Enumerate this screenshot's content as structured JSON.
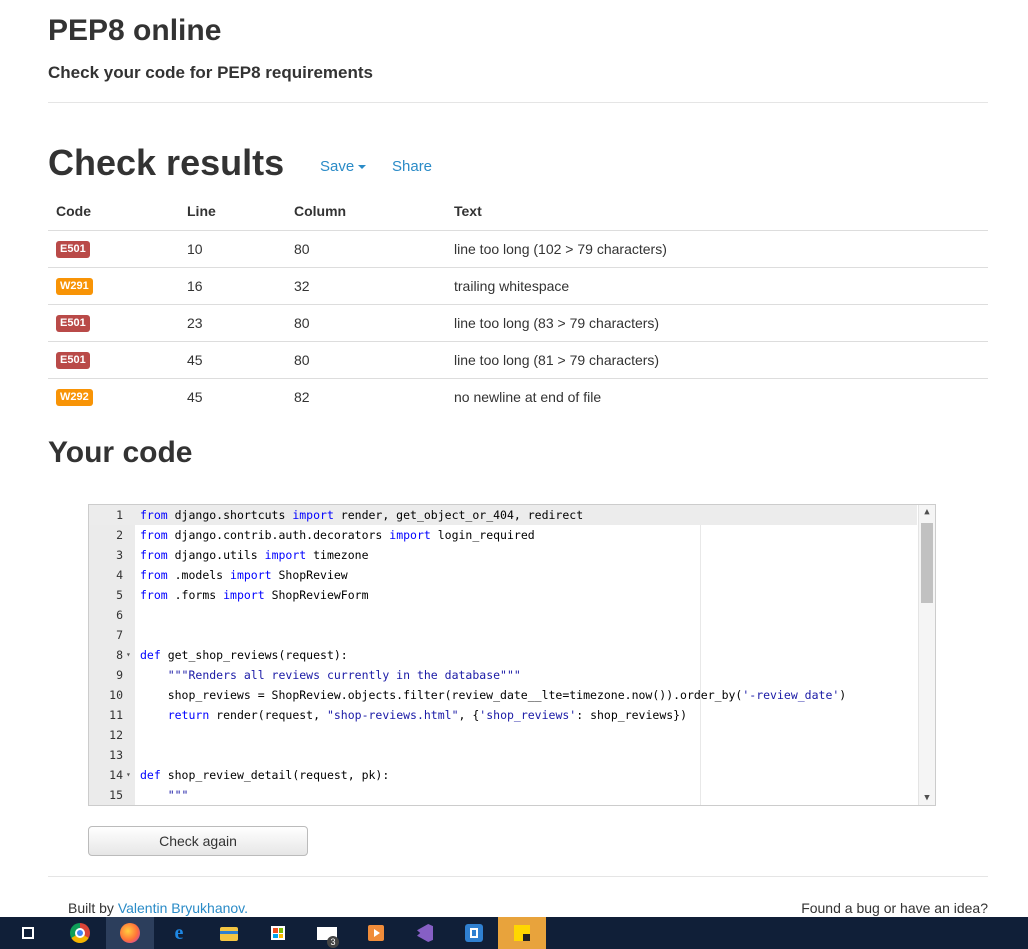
{
  "header": {
    "title": "PEP8 online",
    "subtitle": "Check your code for PEP8 requirements"
  },
  "results": {
    "title": "Check results",
    "save_label": "Save",
    "share_label": "Share",
    "columns": [
      "Code",
      "Line",
      "Column",
      "Text"
    ],
    "rows": [
      {
        "code": "E501",
        "type": "error",
        "line": "10",
        "column": "80",
        "text": "line too long (102 > 79 characters)"
      },
      {
        "code": "W291",
        "type": "warning",
        "line": "16",
        "column": "32",
        "text": "trailing whitespace"
      },
      {
        "code": "E501",
        "type": "error",
        "line": "23",
        "column": "80",
        "text": "line too long (83 > 79 characters)"
      },
      {
        "code": "E501",
        "type": "error",
        "line": "45",
        "column": "80",
        "text": "line too long (81 > 79 characters)"
      },
      {
        "code": "W292",
        "type": "warning",
        "line": "45",
        "column": "82",
        "text": "no newline at end of file"
      }
    ]
  },
  "code_section": {
    "title": "Your code",
    "lines": [
      {
        "n": "1",
        "fold": "",
        "text": "from django.shortcuts import render, get_object_or_404, redirect"
      },
      {
        "n": "2",
        "fold": "",
        "text": "from django.contrib.auth.decorators import login_required"
      },
      {
        "n": "3",
        "fold": "",
        "text": "from django.utils import timezone"
      },
      {
        "n": "4",
        "fold": "",
        "text": "from .models import ShopReview"
      },
      {
        "n": "5",
        "fold": "",
        "text": "from .forms import ShopReviewForm"
      },
      {
        "n": "6",
        "fold": "",
        "text": ""
      },
      {
        "n": "7",
        "fold": "",
        "text": ""
      },
      {
        "n": "8",
        "fold": "▾",
        "text": "def get_shop_reviews(request):"
      },
      {
        "n": "9",
        "fold": "",
        "text": "    \"\"\"Renders all reviews currently in the database\"\"\""
      },
      {
        "n": "10",
        "fold": "",
        "text": "    shop_reviews = ShopReview.objects.filter(review_date__lte=timezone.now()).order_by('-review_date')"
      },
      {
        "n": "11",
        "fold": "",
        "text": "    return render(request, \"shop-reviews.html\", {'shop_reviews': shop_reviews})"
      },
      {
        "n": "12",
        "fold": "",
        "text": ""
      },
      {
        "n": "13",
        "fold": "",
        "text": ""
      },
      {
        "n": "14",
        "fold": "▾",
        "text": "def shop_review_detail(request, pk):"
      },
      {
        "n": "15",
        "fold": "",
        "text": "    \"\"\""
      }
    ],
    "check_again_label": "Check again"
  },
  "footer": {
    "built_by_prefix": "Built by ",
    "author": "Valentin Bryukhanov.",
    "right_text": "Found a bug or have an idea?"
  },
  "taskbar": {
    "items": [
      {
        "icon": "task-view-icon",
        "color": "#ffffff"
      },
      {
        "icon": "chrome-icon",
        "color": "#4285f4"
      },
      {
        "icon": "firefox-icon",
        "color": "#ff7139"
      },
      {
        "icon": "edge-icon",
        "color": "#1e88e5"
      },
      {
        "icon": "file-explorer-icon",
        "color": "#f4c542"
      },
      {
        "icon": "store-icon",
        "color": "#ffffff"
      },
      {
        "icon": "mail-icon",
        "color": "#ffffff"
      },
      {
        "icon": "media-player-icon",
        "color": "#f08c3a"
      },
      {
        "icon": "visual-studio-icon",
        "color": "#865fc5"
      },
      {
        "icon": "sourcetree-icon",
        "color": "#2f80d1"
      },
      {
        "icon": "sticky-notes-icon",
        "color": "#ffd700"
      }
    ],
    "mail_badge": "3"
  }
}
